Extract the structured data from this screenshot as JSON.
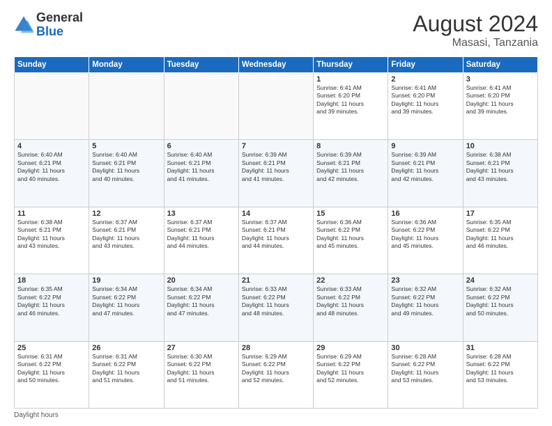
{
  "logo": {
    "general": "General",
    "blue": "Blue"
  },
  "title": {
    "month_year": "August 2024",
    "location": "Masasi, Tanzania"
  },
  "headers": [
    "Sunday",
    "Monday",
    "Tuesday",
    "Wednesday",
    "Thursday",
    "Friday",
    "Saturday"
  ],
  "weeks": [
    [
      {
        "day": "",
        "info": ""
      },
      {
        "day": "",
        "info": ""
      },
      {
        "day": "",
        "info": ""
      },
      {
        "day": "",
        "info": ""
      },
      {
        "day": "1",
        "info": "Sunrise: 6:41 AM\nSunset: 6:20 PM\nDaylight: 11 hours\nand 39 minutes."
      },
      {
        "day": "2",
        "info": "Sunrise: 6:41 AM\nSunset: 6:20 PM\nDaylight: 11 hours\nand 39 minutes."
      },
      {
        "day": "3",
        "info": "Sunrise: 6:41 AM\nSunset: 6:20 PM\nDaylight: 11 hours\nand 39 minutes."
      }
    ],
    [
      {
        "day": "4",
        "info": "Sunrise: 6:40 AM\nSunset: 6:21 PM\nDaylight: 11 hours\nand 40 minutes."
      },
      {
        "day": "5",
        "info": "Sunrise: 6:40 AM\nSunset: 6:21 PM\nDaylight: 11 hours\nand 40 minutes."
      },
      {
        "day": "6",
        "info": "Sunrise: 6:40 AM\nSunset: 6:21 PM\nDaylight: 11 hours\nand 41 minutes."
      },
      {
        "day": "7",
        "info": "Sunrise: 6:39 AM\nSunset: 6:21 PM\nDaylight: 11 hours\nand 41 minutes."
      },
      {
        "day": "8",
        "info": "Sunrise: 6:39 AM\nSunset: 6:21 PM\nDaylight: 11 hours\nand 42 minutes."
      },
      {
        "day": "9",
        "info": "Sunrise: 6:39 AM\nSunset: 6:21 PM\nDaylight: 11 hours\nand 42 minutes."
      },
      {
        "day": "10",
        "info": "Sunrise: 6:38 AM\nSunset: 6:21 PM\nDaylight: 11 hours\nand 43 minutes."
      }
    ],
    [
      {
        "day": "11",
        "info": "Sunrise: 6:38 AM\nSunset: 6:21 PM\nDaylight: 11 hours\nand 43 minutes."
      },
      {
        "day": "12",
        "info": "Sunrise: 6:37 AM\nSunset: 6:21 PM\nDaylight: 11 hours\nand 43 minutes."
      },
      {
        "day": "13",
        "info": "Sunrise: 6:37 AM\nSunset: 6:21 PM\nDaylight: 11 hours\nand 44 minutes."
      },
      {
        "day": "14",
        "info": "Sunrise: 6:37 AM\nSunset: 6:21 PM\nDaylight: 11 hours\nand 44 minutes."
      },
      {
        "day": "15",
        "info": "Sunrise: 6:36 AM\nSunset: 6:22 PM\nDaylight: 11 hours\nand 45 minutes."
      },
      {
        "day": "16",
        "info": "Sunrise: 6:36 AM\nSunset: 6:22 PM\nDaylight: 11 hours\nand 45 minutes."
      },
      {
        "day": "17",
        "info": "Sunrise: 6:35 AM\nSunset: 6:22 PM\nDaylight: 11 hours\nand 46 minutes."
      }
    ],
    [
      {
        "day": "18",
        "info": "Sunrise: 6:35 AM\nSunset: 6:22 PM\nDaylight: 11 hours\nand 46 minutes."
      },
      {
        "day": "19",
        "info": "Sunrise: 6:34 AM\nSunset: 6:22 PM\nDaylight: 11 hours\nand 47 minutes."
      },
      {
        "day": "20",
        "info": "Sunrise: 6:34 AM\nSunset: 6:22 PM\nDaylight: 11 hours\nand 47 minutes."
      },
      {
        "day": "21",
        "info": "Sunrise: 6:33 AM\nSunset: 6:22 PM\nDaylight: 11 hours\nand 48 minutes."
      },
      {
        "day": "22",
        "info": "Sunrise: 6:33 AM\nSunset: 6:22 PM\nDaylight: 11 hours\nand 48 minutes."
      },
      {
        "day": "23",
        "info": "Sunrise: 6:32 AM\nSunset: 6:22 PM\nDaylight: 11 hours\nand 49 minutes."
      },
      {
        "day": "24",
        "info": "Sunrise: 6:32 AM\nSunset: 6:22 PM\nDaylight: 11 hours\nand 50 minutes."
      }
    ],
    [
      {
        "day": "25",
        "info": "Sunrise: 6:31 AM\nSunset: 6:22 PM\nDaylight: 11 hours\nand 50 minutes."
      },
      {
        "day": "26",
        "info": "Sunrise: 6:31 AM\nSunset: 6:22 PM\nDaylight: 11 hours\nand 51 minutes."
      },
      {
        "day": "27",
        "info": "Sunrise: 6:30 AM\nSunset: 6:22 PM\nDaylight: 11 hours\nand 51 minutes."
      },
      {
        "day": "28",
        "info": "Sunrise: 6:29 AM\nSunset: 6:22 PM\nDaylight: 11 hours\nand 52 minutes."
      },
      {
        "day": "29",
        "info": "Sunrise: 6:29 AM\nSunset: 6:22 PM\nDaylight: 11 hours\nand 52 minutes."
      },
      {
        "day": "30",
        "info": "Sunrise: 6:28 AM\nSunset: 6:22 PM\nDaylight: 11 hours\nand 53 minutes."
      },
      {
        "day": "31",
        "info": "Sunrise: 6:28 AM\nSunset: 6:22 PM\nDaylight: 11 hours\nand 53 minutes."
      }
    ]
  ],
  "footer": {
    "note": "Daylight hours"
  }
}
